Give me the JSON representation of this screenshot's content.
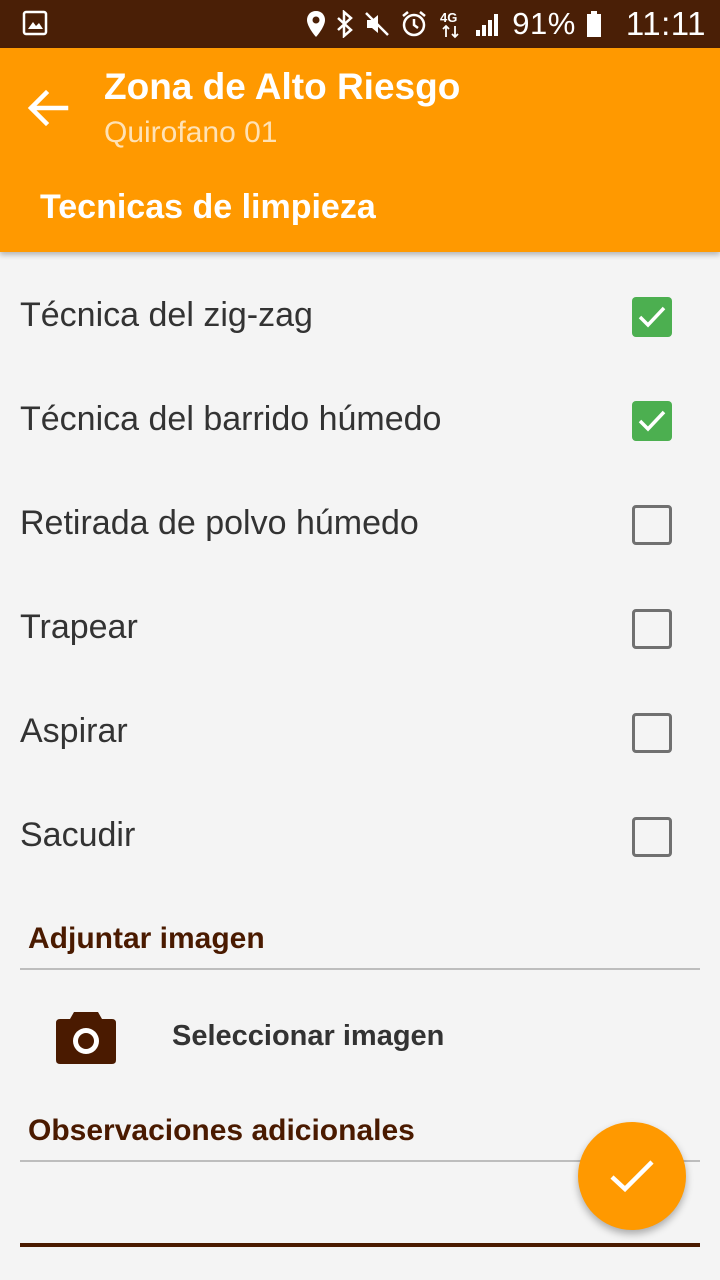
{
  "status_bar": {
    "battery": "91%",
    "time": "11:11",
    "network": "4G",
    "icons": [
      "gallery-icon",
      "location-icon",
      "bluetooth-icon",
      "mute-icon",
      "alarm-icon",
      "network-4g-icon",
      "signal-icon",
      "battery-icon"
    ]
  },
  "app_bar": {
    "title": "Zona de Alto Riesgo",
    "subtitle": "Quirofano 01",
    "section_title": "Tecnicas de limpieza",
    "back_icon": "arrow-back-icon"
  },
  "techniques": [
    {
      "label": "Técnica del zig-zag",
      "checked": true
    },
    {
      "label": "Técnica del barrido húmedo",
      "checked": true
    },
    {
      "label": "Retirada de polvo húmedo",
      "checked": false
    },
    {
      "label": "Trapear",
      "checked": false
    },
    {
      "label": "Aspirar",
      "checked": false
    },
    {
      "label": "Sacudir",
      "checked": false
    }
  ],
  "attach": {
    "header": "Adjuntar imagen",
    "button_label": "Seleccionar imagen",
    "icon": "camera-icon"
  },
  "observations": {
    "header": "Observaciones adicionales",
    "value": ""
  },
  "fab": {
    "icon": "check-icon"
  },
  "colors": {
    "status_bar": "#4a1f06",
    "primary": "#ff9900",
    "checkbox_checked": "#4caf50",
    "header_text": "#4a1a00",
    "background": "#f4f4f4"
  }
}
